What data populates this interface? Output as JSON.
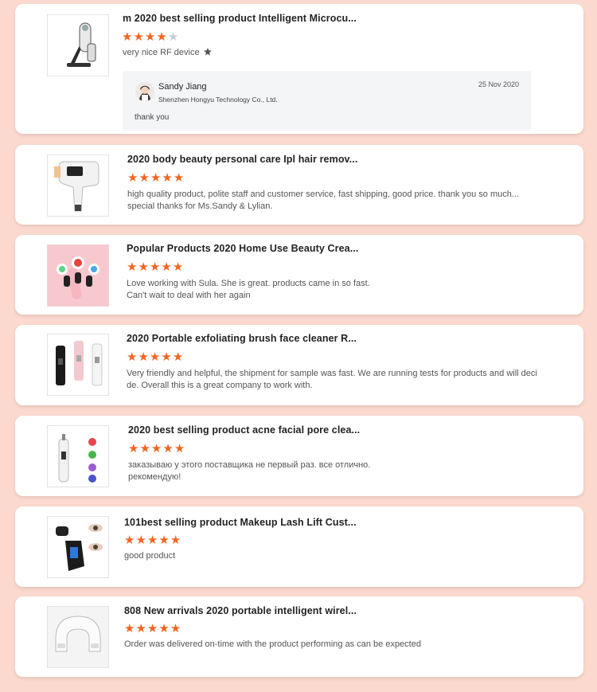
{
  "reviews": [
    {
      "title": "m 2020 best selling product Intelligent Microcu...",
      "rating": 4,
      "comment_lines": [
        "very nice RF device"
      ],
      "comment_icon": "star-badge-icon",
      "reply": {
        "name": "Sandy Jiang",
        "company": "Shenzhen Hongyu Technology Co., Ltd.",
        "date": "25 Nov 2020",
        "text": "thank you"
      }
    },
    {
      "title": "2020 body beauty personal care Ipl hair remov...",
      "rating": 5,
      "comment_lines": [
        "high quality product, polite staff and customer service, fast shipping, good price. thank you so much...",
        "special thanks for Ms.Sandy & Lylian."
      ]
    },
    {
      "title": "Popular Products 2020 Home Use Beauty Crea...",
      "rating": 5,
      "comment_lines": [
        "Love working with Sula. She is great. products came in so fast.",
        "Can't wait to deal with her again"
      ]
    },
    {
      "title": "2020 Portable exfoliating brush face cleaner R...",
      "rating": 5,
      "comment_lines": [
        "Very friendly and helpful, the shipment for sample was fast. We are running tests for products and will deci",
        "de. Overall this is a great company to work with."
      ]
    },
    {
      "title": "2020 best selling product acne facial pore clea...",
      "rating": 5,
      "comment_lines": [
        "заказываю у этого поставщика не первый раз. все отлично.",
        "рекомендую!"
      ]
    },
    {
      "title": "101best selling product Makeup Lash Lift Cust...",
      "rating": 5,
      "comment_lines": [
        "good product"
      ]
    },
    {
      "title": "808 New arrivals 2020 portable intelligent wirel...",
      "rating": 5,
      "comment_lines": [
        "Order was delivered on-time with the product performing as can be expected"
      ]
    }
  ],
  "colors": {
    "background": "#fbd9cf",
    "star_filled": "#f26522",
    "star_empty": "#c9ccd3"
  },
  "star_glyph": "★"
}
